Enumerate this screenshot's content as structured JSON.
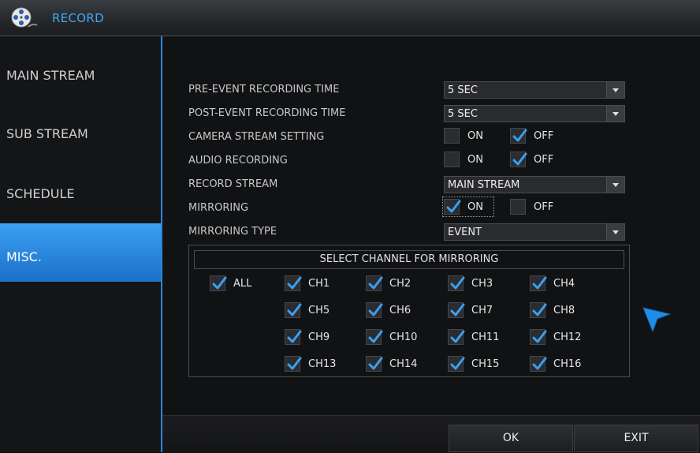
{
  "window": {
    "title": "RECORD",
    "icon": "film-reel-icon"
  },
  "sidebar": {
    "items": [
      {
        "label": "MAIN STREAM",
        "active": false
      },
      {
        "label": "SUB STREAM",
        "active": false
      },
      {
        "label": "SCHEDULE",
        "active": false
      },
      {
        "label": "MISC.",
        "active": true
      }
    ]
  },
  "settings": {
    "pre_event": {
      "label": "PRE-EVENT RECORDING TIME",
      "value": "5 SEC"
    },
    "post_event": {
      "label": "POST-EVENT RECORDING TIME",
      "value": "5 SEC"
    },
    "camera_stream": {
      "label": "CAMERA STREAM SETTING",
      "on_label": "ON",
      "off_label": "OFF",
      "on": false,
      "off": true
    },
    "audio_recording": {
      "label": "AUDIO RECORDING",
      "on_label": "ON",
      "off_label": "OFF",
      "on": false,
      "off": true
    },
    "record_stream": {
      "label": "RECORD STREAM",
      "value": "MAIN STREAM"
    },
    "mirroring": {
      "label": "MIRRORING",
      "on_label": "ON",
      "off_label": "OFF",
      "on": true,
      "off": false
    },
    "mirroring_type": {
      "label": "MIRRORING TYPE",
      "value": "EVENT"
    }
  },
  "mirror_channels": {
    "header": "SELECT CHANNEL FOR MIRRORING",
    "all": {
      "label": "ALL",
      "checked": true
    },
    "channels": [
      {
        "label": "CH1",
        "checked": true
      },
      {
        "label": "CH2",
        "checked": true
      },
      {
        "label": "CH3",
        "checked": true
      },
      {
        "label": "CH4",
        "checked": true
      },
      {
        "label": "CH5",
        "checked": true
      },
      {
        "label": "CH6",
        "checked": true
      },
      {
        "label": "CH7",
        "checked": true
      },
      {
        "label": "CH8",
        "checked": true
      },
      {
        "label": "CH9",
        "checked": true
      },
      {
        "label": "CH10",
        "checked": true
      },
      {
        "label": "CH11",
        "checked": true
      },
      {
        "label": "CH12",
        "checked": true
      },
      {
        "label": "CH13",
        "checked": true
      },
      {
        "label": "CH14",
        "checked": true
      },
      {
        "label": "CH15",
        "checked": true
      },
      {
        "label": "CH16",
        "checked": true
      }
    ]
  },
  "buttons": {
    "ok": "OK",
    "exit": "EXIT"
  },
  "colors": {
    "accent": "#2f86d3",
    "check": "#3aa0f0",
    "active_tab": "#2a88dc"
  }
}
